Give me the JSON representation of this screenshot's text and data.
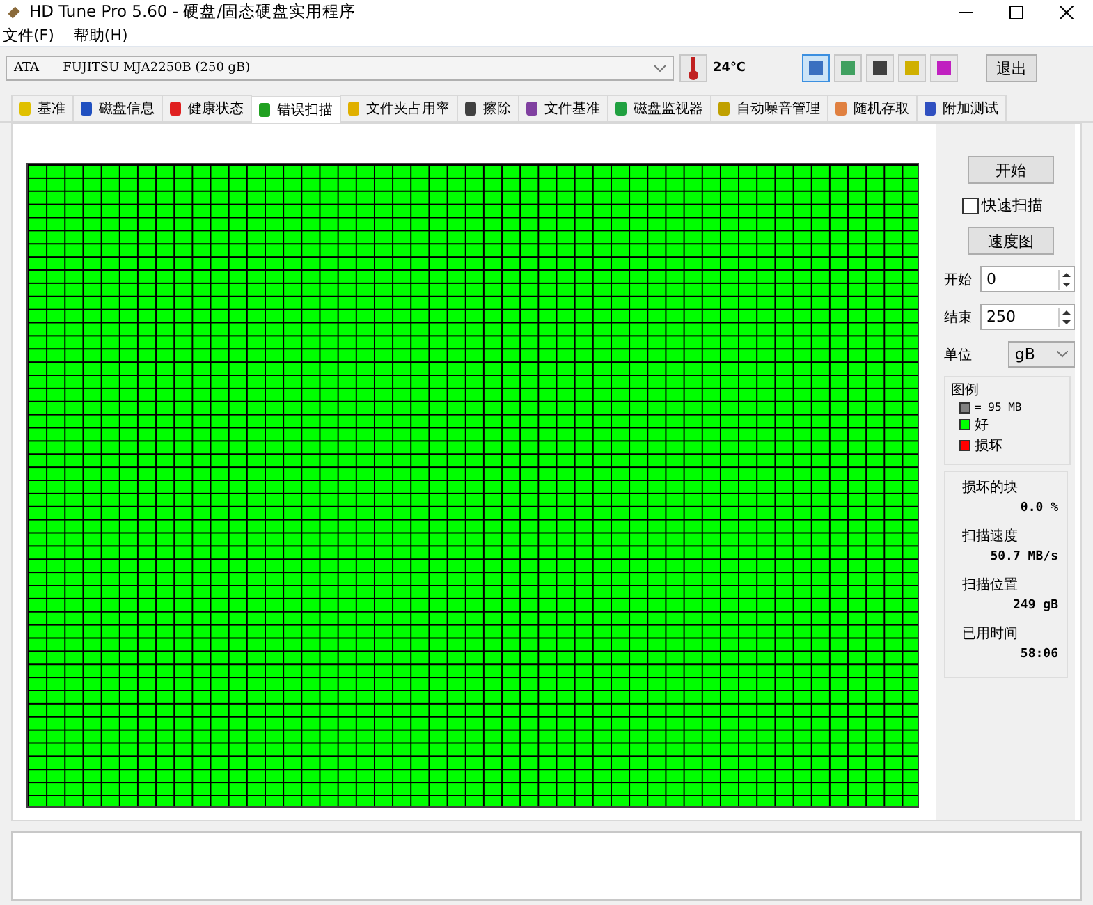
{
  "window": {
    "title": "HD Tune Pro 5.60 - 硬盘/固态硬盘实用程序"
  },
  "menu": [
    "文件(F)",
    "帮助(H)"
  ],
  "toolbar": {
    "drive": "ATA      FUJITSU MJA2250B (250 gB)",
    "temperature": "24℃",
    "buttons": [
      {
        "kind": "copy",
        "selected": true
      },
      {
        "kind": "copy2",
        "selected": false
      },
      {
        "kind": "camera",
        "selected": false
      },
      {
        "kind": "options",
        "selected": false
      },
      {
        "kind": "save",
        "selected": false
      }
    ],
    "exit": "退出"
  },
  "tabs": [
    {
      "label": "基准",
      "kind": "bulb",
      "selected": false
    },
    {
      "label": "磁盘信息",
      "kind": "info",
      "selected": false
    },
    {
      "label": "健康状态",
      "kind": "health",
      "selected": false
    },
    {
      "label": "错误扫描",
      "kind": "search",
      "selected": true
    },
    {
      "label": "文件夹占用率",
      "kind": "folder",
      "selected": false
    },
    {
      "label": "擦除",
      "kind": "trash",
      "selected": false
    },
    {
      "label": "文件基准",
      "kind": "file",
      "selected": false
    },
    {
      "label": "磁盘监视器",
      "kind": "monitor",
      "selected": false
    },
    {
      "label": "自动噪音管理",
      "kind": "speaker",
      "selected": false
    },
    {
      "label": "随机存取",
      "kind": "random",
      "selected": false
    },
    {
      "label": "附加测试",
      "kind": "extra",
      "selected": false
    }
  ],
  "panel": {
    "start_button": "开始",
    "quick_scan": {
      "label": "快速扫描",
      "checked": false
    },
    "speed_map_button": "速度图",
    "start": {
      "label": "开始",
      "value": "0"
    },
    "end": {
      "label": "结束",
      "value": "250"
    },
    "unit": {
      "label": "单位",
      "value": "gB"
    },
    "legend": {
      "title": "图例",
      "items": [
        {
          "label": "= 95 MB",
          "color": "#808080"
        },
        {
          "label": "好",
          "color": "#00ff00"
        },
        {
          "label": "损坏",
          "color": "#ff0000"
        }
      ]
    },
    "stats": [
      {
        "label": "损坏的块",
        "value": "0.0 %"
      },
      {
        "label": "扫描速度",
        "value": "50.7 MB/s"
      },
      {
        "label": "扫描位置",
        "value": "249 gB"
      },
      {
        "label": "已用时间",
        "value": "58:06"
      }
    ]
  }
}
